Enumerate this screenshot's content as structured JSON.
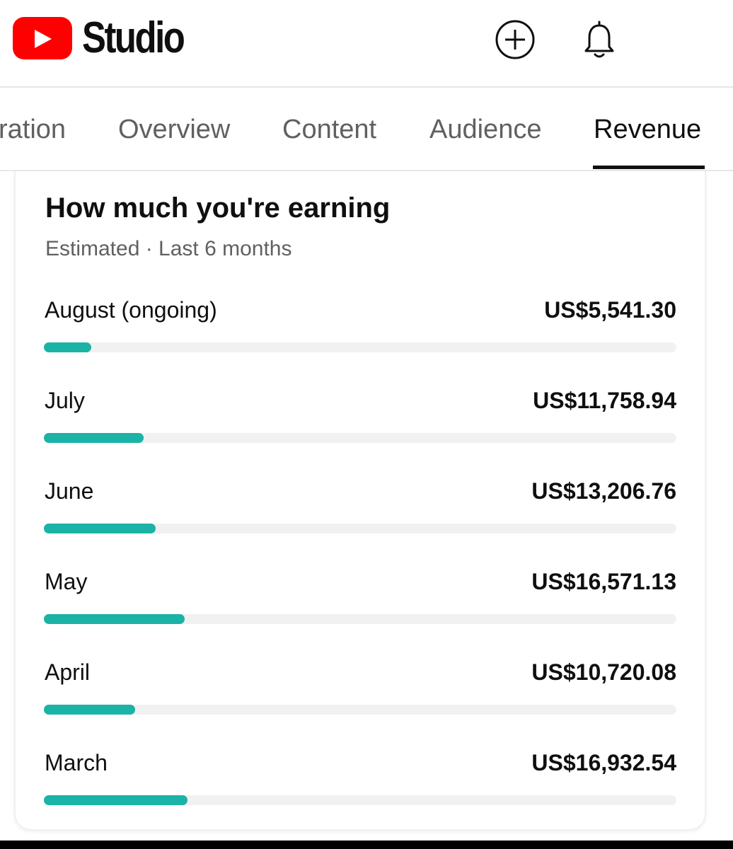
{
  "header": {
    "app_name": "Studio",
    "icons": {
      "logo": "youtube-play-icon",
      "create": "plus-circle-icon",
      "notifications": "bell-icon"
    },
    "brand_color": "#ff0000"
  },
  "tabs": [
    {
      "label": "ration",
      "active": false
    },
    {
      "label": "Overview",
      "active": false
    },
    {
      "label": "Content",
      "active": false
    },
    {
      "label": "Audience",
      "active": false
    },
    {
      "label": "Revenue",
      "active": true
    }
  ],
  "card": {
    "title": "How much you're earning",
    "subtitle": "Estimated · Last 6 months",
    "bar_color": "#1ab3a6",
    "rows": [
      {
        "label": "August (ongoing)",
        "value": "US$5,541.30",
        "amount": 5541.3,
        "fraction": 0.075
      },
      {
        "label": "July",
        "value": "US$11,758.94",
        "amount": 11758.94,
        "fraction": 0.158
      },
      {
        "label": "June",
        "value": "US$13,206.76",
        "amount": 13206.76,
        "fraction": 0.177
      },
      {
        "label": "May",
        "value": "US$16,571.13",
        "amount": 16571.13,
        "fraction": 0.223
      },
      {
        "label": "April",
        "value": "US$10,720.08",
        "amount": 10720.08,
        "fraction": 0.144
      },
      {
        "label": "March",
        "value": "US$16,932.54",
        "amount": 16932.54,
        "fraction": 0.227
      }
    ]
  }
}
